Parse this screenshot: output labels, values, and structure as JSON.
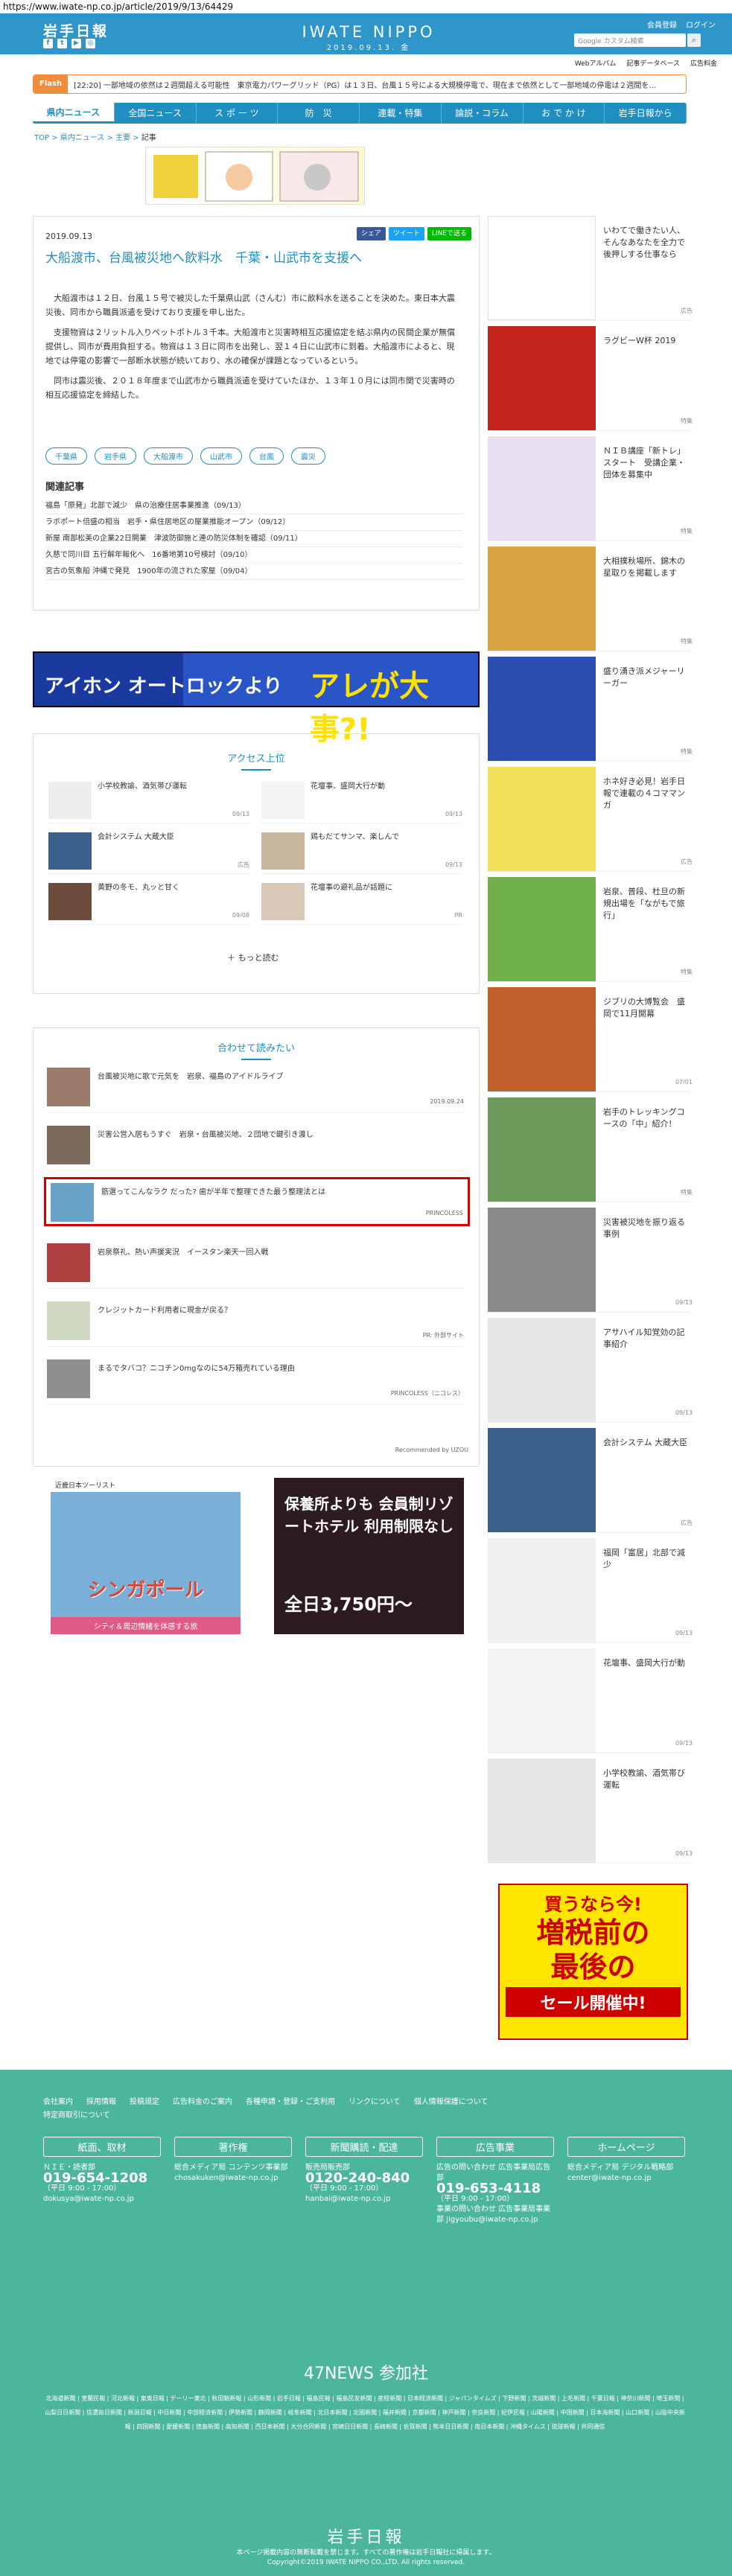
{
  "url": "https://www.iwate-np.co.jp/article/2019/9/13/64429",
  "header": {
    "logo": "岩手日報",
    "mast": "IWATE NIPPO",
    "mast_date": "2019.09.13. 金",
    "links": [
      "会員登録",
      "ログイン"
    ],
    "sub_links": [
      "Webアルバム",
      "記事データベース",
      "広告料金"
    ],
    "search_placeholder": "Google カスタム検索"
  },
  "flash": {
    "tag": "Flash",
    "text": "[22:20] 一部地域の依然は２週間超える可能性　東京電力パワーグリッド（PG）は１３日、台風１５号による大規模停電で、現在まで依然として一部地域の停電は２週間を…"
  },
  "nav": [
    "県内ニュース",
    "全国ニュース",
    "ス ポ ー ツ",
    "防　災",
    "連載・特集",
    "論説・コラム",
    "お で か け",
    "岩手日報から"
  ],
  "breadcrumb": [
    "TOP",
    "県内ニュース",
    "主要",
    "記事"
  ],
  "article": {
    "date": "2019.09.13",
    "share": [
      "シェア",
      "ツイート",
      "LINEで送る"
    ],
    "title": "大船渡市、台風被災地へ飲料水　千葉・山武市を支援へ",
    "paragraphs": [
      "大船渡市は１２日、台風１５号で被災した千葉県山武（さんむ）市に飲料水を送ることを決めた。東日本大震災後、同市から職員派遣を受けており支援を申し出た。",
      "支援物資は２リットル入りペットボトル３千本。大船渡市と災害時相互応援協定を結ぶ県内の民間企業が無償提供し、同市が費用負担する。物資は１３日に同市を出発し、翌１４日に山武市に到着。大船渡市によると、現地では停電の影響で一部断水状態が続いており、水の確保が課題となっているという。",
      "同市は震災後、２０１８年度まで山武市から職員派遣を受けていたほか、１３年１０月には同市関で災害時の相互応援協定を締結した。"
    ],
    "tags": [
      "千葉県",
      "岩手県",
      "大船渡市",
      "山武市",
      "台風",
      "震災"
    ],
    "related_title": "関連記事",
    "related": [
      "福島「原発」北部で減少　県の治療住居事業推進（09/13）",
      "ラボポート倍盛の相当　岩手・県住居地区の屋業推能オープン（09/12）",
      "新屋 南部松美の企業22日開業　津波防御施と連の防災体制を確認（09/11）",
      "久慈で同川目 五行解年報化へ　16番地第10号検討（09/10）",
      "宮古の気象船 沖縄で発見　1900年の流された家屋（09/04）"
    ]
  },
  "ad_banner": {
    "left": "アイホン オートロックより",
    "right": "アレが大事?!"
  },
  "access": {
    "title": "アクセス上位",
    "items": [
      {
        "text": "小学校教諭、酒気帯び運転",
        "date": "09/13"
      },
      {
        "text": "花壇事、盛岡大行が動",
        "date": "09/13"
      },
      {
        "text": "会計システム 大蔵大臣",
        "date": "広告"
      },
      {
        "text": "鶏もだてサンマ、楽しんで",
        "date": "09/13"
      },
      {
        "text": "黄野の冬モ、丸ッと甘く",
        "date": "09/08"
      },
      {
        "text": "花壇事の避礼品が話題に",
        "date": "PR"
      }
    ],
    "more": "もっと読む"
  },
  "read": {
    "title": "合わせて読みたい",
    "items": [
      {
        "text": "台風被災地に歌で元気を　岩泉、福島のアイドルライブ",
        "src": "2019.09.24"
      },
      {
        "text": "災害公営入居もうすぐ　岩泉・台風被災地、２団地で鍵引き渡し",
        "src": ""
      },
      {
        "text": "筋選ってこんなラク だった? 歯が半年で整理できた最う整理法とは",
        "src": "PRINCOLESS"
      },
      {
        "text": "岩泉祭礼、熱い声援実況　イースタン楽天一回入戦",
        "src": ""
      },
      {
        "text": "クレジットカード利用者に現金が戻る？",
        "src": "PR: 外部サイト"
      },
      {
        "text": "まるでタバコ？ニコチン0mgなのに54万箱売れている理由",
        "src": "PRINCOLESS（ニコレス）"
      }
    ],
    "powered": "Recommended by UZOU"
  },
  "ads": {
    "left_top": "近畿日本ツーリスト",
    "left_main": "シンガポール",
    "left_sub": "シティ＆周辺情緒を体感する旅",
    "right_main": "保養所よりも 会員制リゾートホテル 利用制限なし",
    "right_price": "全日3,750円〜"
  },
  "sidebar": {
    "items": [
      {
        "text": "いわてで働きたい人、そんなあなたを全力で後押しする仕事なら",
        "src": "広告"
      },
      {
        "text": "ラグビーW杯 2019",
        "src": "特集"
      },
      {
        "text": "ＮＩＢ講座「新トレ」スタート　受講企業・団体を募集中",
        "src": "特集"
      },
      {
        "text": "大相撲秋場所、錦木の星取りを掲載します",
        "src": "特集"
      },
      {
        "text": "盛り湧き派メジャーリーガー",
        "src": "特集"
      },
      {
        "text": "ホネ好き必見！岩手日報で連載の４コママンガ",
        "src": "広告"
      },
      {
        "text": "岩泉、普段、杜旦の新規出場を「ながもで旅行」",
        "src": "特集"
      },
      {
        "text": "ジブリの大博覧会　盛岡で11月開幕",
        "src": "07/01"
      },
      {
        "text": "岩手のトレッキングコースの「中」紹介！",
        "src": "特集"
      },
      {
        "text": "災害被災地を振り返る事例",
        "src": "09/13"
      },
      {
        "text": "アサハイル知覚効の記事紹介",
        "src": "09/13"
      },
      {
        "text": "会計システム 大蔵大臣",
        "src": "広告"
      },
      {
        "text": "福岡「富居」北部で減少",
        "src": "09/13"
      },
      {
        "text": "花壇事、盛岡大行が動",
        "src": "09/13"
      },
      {
        "text": "小学校教諭、酒気帯び運転",
        "src": "09/13"
      }
    ],
    "big_ad_l1": "買うなら今!",
    "big_ad_l2": "増税前の",
    "big_ad_l3": "最後の",
    "big_ad_l4": "セール開催中!"
  },
  "footer": {
    "links1": [
      "会社案内",
      "採用情報",
      "投稿規定",
      "広告料金のご案内",
      "各種申請・登録・ご支利用",
      "リンクについて",
      "個人情報保護について"
    ],
    "links2": "特定商取引について",
    "cols": [
      {
        "h": "紙面、取材",
        "dept": "ＮＩＥ・読者部",
        "tel": "019-654-1208",
        "hours": "（平日 9:00 - 17:00）",
        "mail": "dokusya@iwate-np.co.jp"
      },
      {
        "h": "著作権",
        "dept": "総合メディア局 コンテンツ事業部",
        "tel": "",
        "hours": "",
        "mail": "chosakuken@iwate-np.co.jp"
      },
      {
        "h": "新聞購読・配達",
        "dept": "販売局販売部",
        "tel": "0120-240-840",
        "hours": "（平日 9:00 - 17:00）",
        "mail": "hanbai@iwate-np.co.jp"
      },
      {
        "h": "広告事業",
        "dept": "広告の問い合わせ 広告事業局広告部",
        "tel": "019-653-4118",
        "hours": "（平日 9:00 - 17:00）",
        "mail": "事業の問い合わせ 広告事業局事業部 jigyoubu@iwate-np.co.jp"
      },
      {
        "h": "ホームページ",
        "dept": "総合メディア局 デジタル戦略部",
        "tel": "",
        "hours": "",
        "mail": "center@iwate-np.co.jp"
      }
    ],
    "n47": "47NEWS 参加社",
    "papers": "北海道新聞 | 室蘭民報 | 河北新報 | 東奥日報 | デーリー東北 | 秋田魁新報 | 山形新聞 | 岩手日報 | 福島民報 | 福島民友新聞 | 産経新聞 | 日本経済新聞 | ジャパンタイムズ | 下野新聞 | 茨城新聞 | 上毛新聞 | 千葉日報 | 神奈川新聞 | 埼玉新聞 | 山梨日日新聞 | 信濃毎日新聞 | 新潟日報 | 中日新聞 | 中部経済新聞 | 伊勢新聞 | 静岡新聞 | 岐阜新聞 | 北日本新聞 | 北國新聞 | 福井新聞 | 京都新聞 | 神戸新聞 | 奈良新聞 | 紀伊民報 | 山陽新聞 | 中国新聞 | 日本海新聞 | 山口新聞 | 山陰中央新報 | 四国新聞 | 愛媛新聞 | 徳島新聞 | 高知新聞 | 西日本新聞 | 大分合同新聞 | 宮崎日日新聞 | 長崎新聞 | 佐賀新聞 | 熊本日日新聞 | 南日本新聞 | 沖縄タイムス | 琉球新報 | 共同通信",
    "logo": "岩手日報",
    "copy1": "本ページ掲載内容の無断転載を禁じます。すべての著作権は岩手日報社に帰属します。",
    "copy2": "Copyright©2019 IWATE NIPPO CO.,LTD. All rights reserved."
  }
}
